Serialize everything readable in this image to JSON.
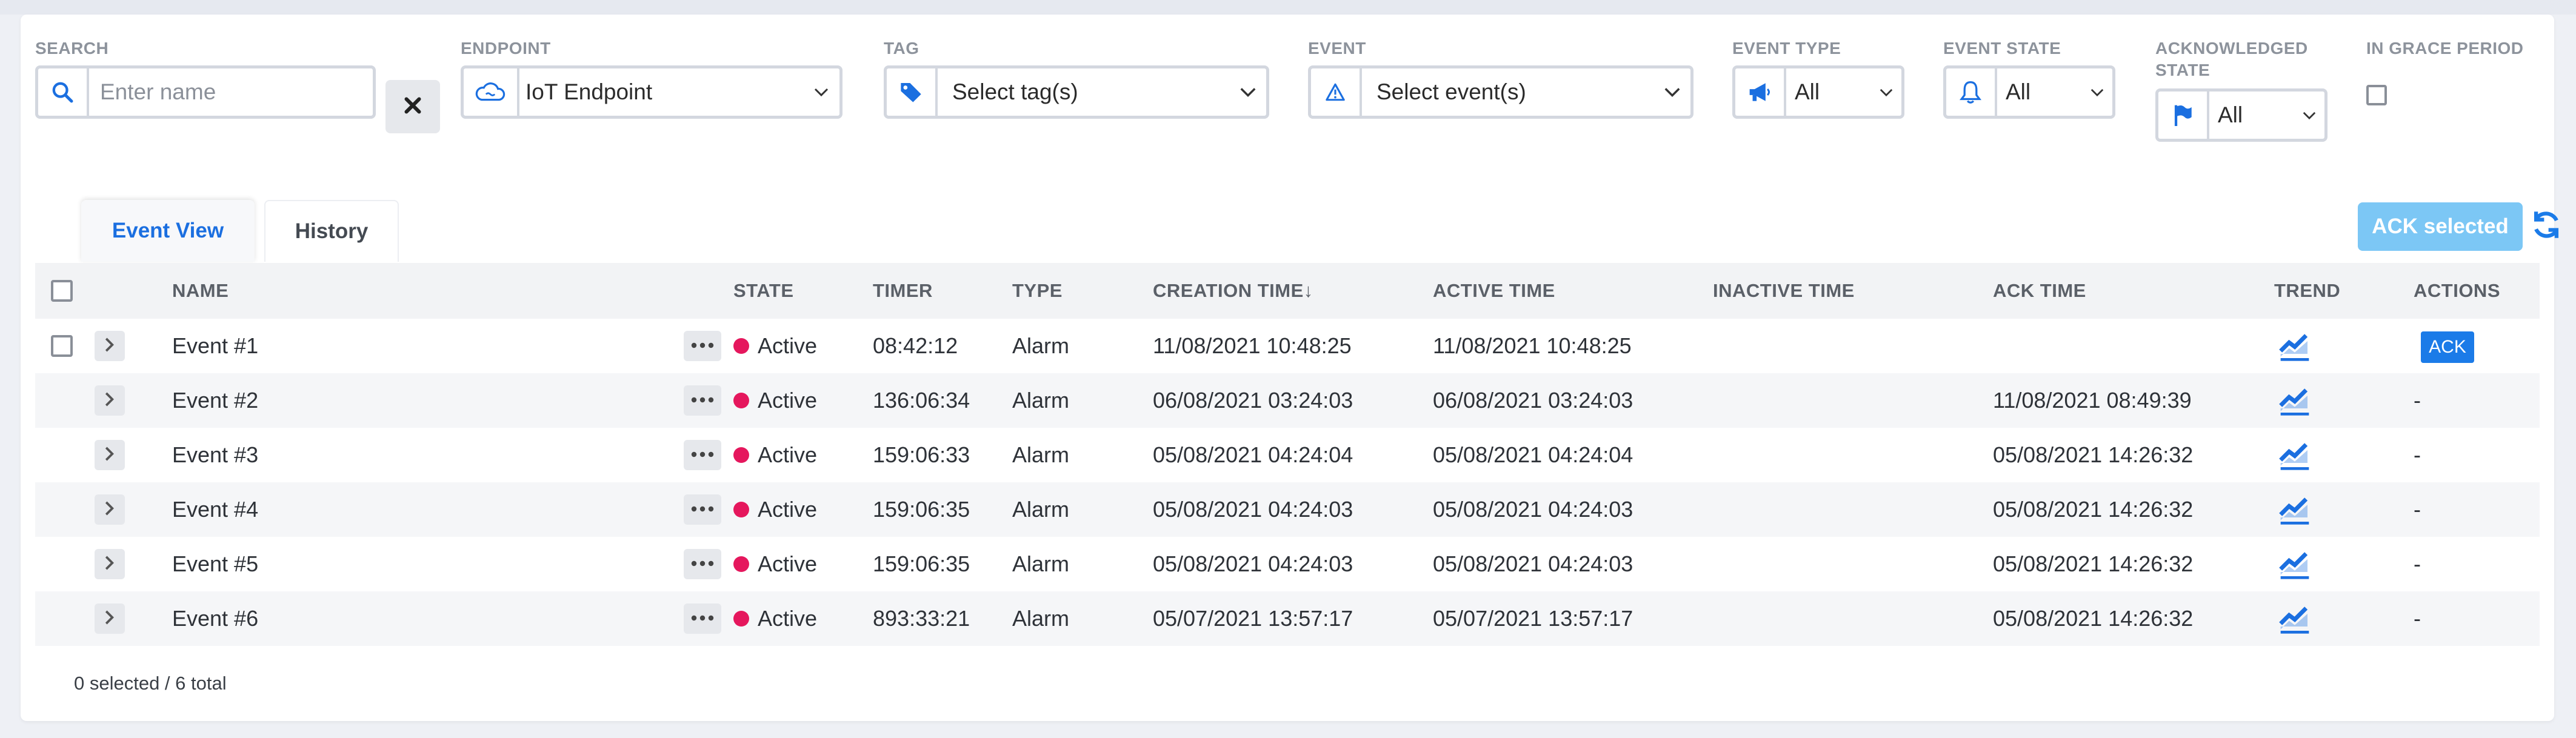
{
  "filters": {
    "search": {
      "label": "SEARCH",
      "placeholder": "Enter name",
      "value": ""
    },
    "endpoint": {
      "label": "ENDPOINT",
      "value": "IoT Endpoint"
    },
    "tag": {
      "label": "TAG",
      "value": "Select tag(s)"
    },
    "event": {
      "label": "EVENT",
      "value": "Select event(s)"
    },
    "event_type": {
      "label": "EVENT TYPE",
      "value": "All"
    },
    "event_state": {
      "label": "EVENT STATE",
      "value": "All"
    },
    "ack_state": {
      "label_line1": "ACKNOWLEDGED",
      "label_line2": "STATE",
      "value": "All"
    },
    "grace": {
      "label": "IN GRACE PERIOD",
      "checked": false
    }
  },
  "tabs": [
    {
      "label": "Event View",
      "active": true
    },
    {
      "label": "History",
      "active": false
    }
  ],
  "toolbar": {
    "ack_selected_label": "ACK selected"
  },
  "table": {
    "columns": {
      "name": "NAME",
      "state": "STATE",
      "timer": "TIMER",
      "type": "TYPE",
      "creation": "CREATION TIME↓",
      "active": "ACTIVE TIME",
      "inactive": "INACTIVE TIME",
      "ack": "ACK TIME",
      "trend": "TREND",
      "actions": "ACTIONS"
    },
    "rows": [
      {
        "name": "Event #1",
        "state": "Active",
        "timer": "08:42:12",
        "type": "Alarm",
        "creation": "11/08/2021 10:48:25",
        "active": "11/08/2021 10:48:25",
        "inactive": "",
        "ack": "",
        "action": "ACK"
      },
      {
        "name": "Event #2",
        "state": "Active",
        "timer": "136:06:34",
        "type": "Alarm",
        "creation": "06/08/2021 03:24:03",
        "active": "06/08/2021 03:24:03",
        "inactive": "",
        "ack": "11/08/2021 08:49:39",
        "action": "-"
      },
      {
        "name": "Event #3",
        "state": "Active",
        "timer": "159:06:33",
        "type": "Alarm",
        "creation": "05/08/2021 04:24:04",
        "active": "05/08/2021 04:24:04",
        "inactive": "",
        "ack": "05/08/2021 14:26:32",
        "action": "-"
      },
      {
        "name": "Event #4",
        "state": "Active",
        "timer": "159:06:35",
        "type": "Alarm",
        "creation": "05/08/2021 04:24:03",
        "active": "05/08/2021 04:24:03",
        "inactive": "",
        "ack": "05/08/2021 14:26:32",
        "action": "-"
      },
      {
        "name": "Event #5",
        "state": "Active",
        "timer": "159:06:35",
        "type": "Alarm",
        "creation": "05/08/2021 04:24:03",
        "active": "05/08/2021 04:24:03",
        "inactive": "",
        "ack": "05/08/2021 14:26:32",
        "action": "-"
      },
      {
        "name": "Event #6",
        "state": "Active",
        "timer": "893:33:21",
        "type": "Alarm",
        "creation": "05/07/2021 13:57:17",
        "active": "05/07/2021 13:57:17",
        "inactive": "",
        "ack": "05/08/2021 14:26:32",
        "action": "-"
      }
    ]
  },
  "footer": {
    "summary": "0 selected / 6 total"
  },
  "colors": {
    "accent": "#1b6fe0",
    "active_dot": "#e5175d",
    "ack_button": "#7cc7f5"
  },
  "icons": [
    "search-icon",
    "close-icon",
    "cloud-icon",
    "tag-icon",
    "warning-icon",
    "megaphone-icon",
    "bell-icon",
    "flag-icon",
    "chevron-down-icon",
    "chevron-right-icon",
    "more-icon",
    "trend-icon",
    "refresh-icon"
  ]
}
